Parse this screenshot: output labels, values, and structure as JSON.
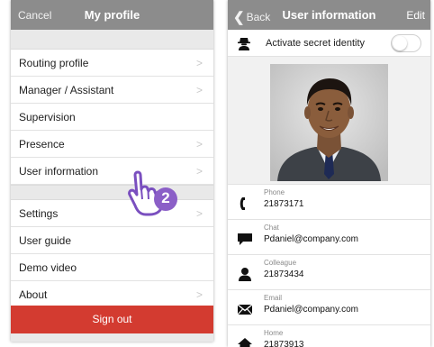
{
  "left_screen": {
    "navbar": {
      "cancel_label": "Cancel",
      "title": "My profile"
    },
    "menu_group_1": [
      {
        "label": "Routing profile",
        "chevron": true
      },
      {
        "label": "Manager / Assistant",
        "chevron": true
      },
      {
        "label": "Supervision",
        "chevron": false
      },
      {
        "label": "Presence",
        "chevron": true
      },
      {
        "label": "User information",
        "chevron": true
      }
    ],
    "menu_group_2": [
      {
        "label": "Settings",
        "chevron": true
      },
      {
        "label": "User guide",
        "chevron": false
      },
      {
        "label": "Demo video",
        "chevron": false
      },
      {
        "label": "About",
        "chevron": true
      }
    ],
    "sign_out_label": "Sign out",
    "chevron_glyph": ">",
    "step_badge": "2"
  },
  "right_screen": {
    "navbar": {
      "back_label": "Back",
      "back_icon": "chevron-left-icon",
      "title": "User information",
      "edit_label": "Edit"
    },
    "secret_identity": {
      "label": "Activate secret identity",
      "icon": "spy-icon",
      "enabled": false
    },
    "contact_rows": [
      {
        "caption": "Phone",
        "value": "21873171",
        "icon": "phone-icon"
      },
      {
        "caption": "Chat",
        "value": "Pdaniel@company.com",
        "icon": "chat-icon"
      },
      {
        "caption": "Colleague",
        "value": "21873434",
        "icon": "colleague-icon"
      },
      {
        "caption": "Email",
        "value": "Pdaniel@company.com",
        "icon": "email-icon"
      },
      {
        "caption": "Home",
        "value": "21873913",
        "icon": "home-icon"
      }
    ]
  },
  "colors": {
    "navbar": "#8c8c8c",
    "sign_out": "#d33b30",
    "badge": "#8b5fc7"
  }
}
